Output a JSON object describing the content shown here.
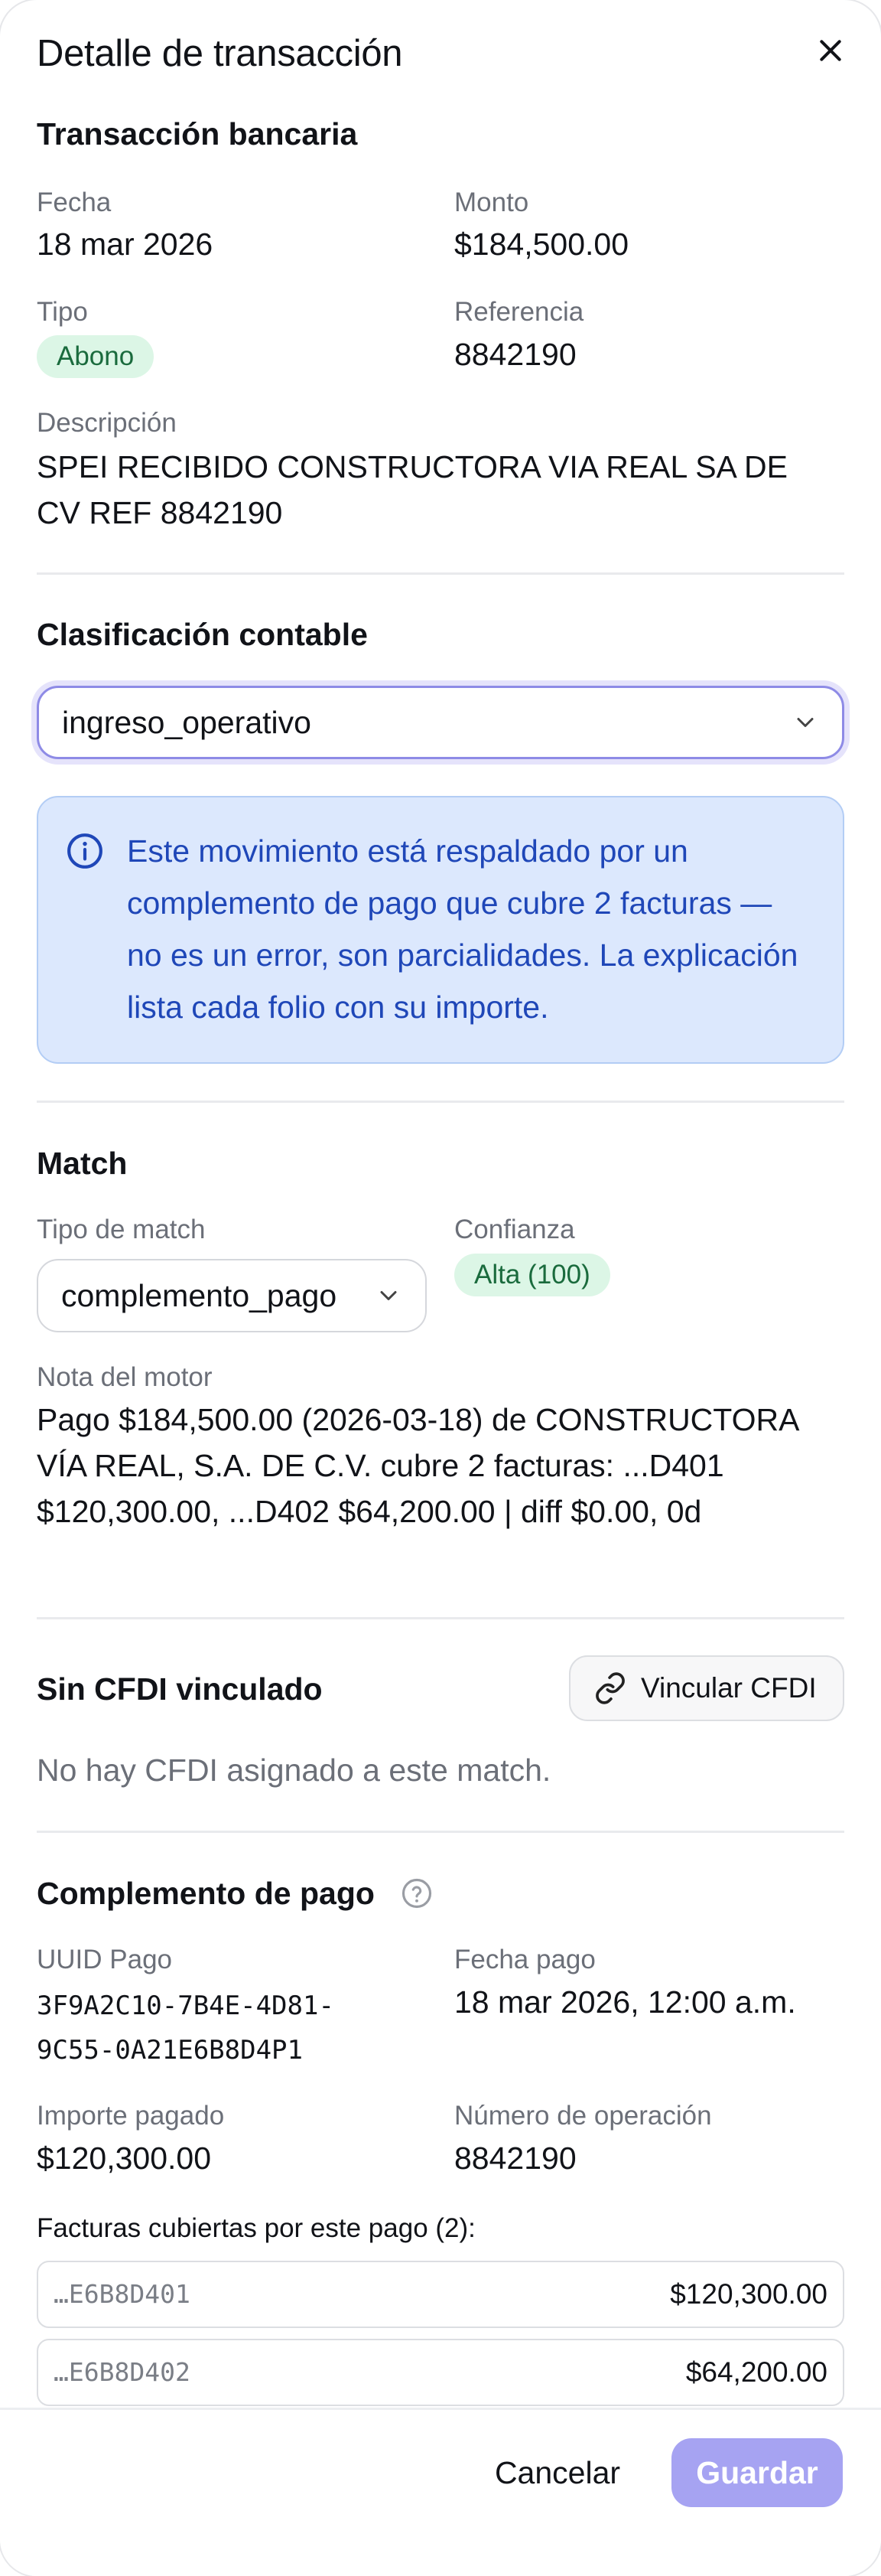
{
  "header": {
    "title": "Detalle de transacción"
  },
  "transaction": {
    "section_title": "Transacción bancaria",
    "fecha_label": "Fecha",
    "fecha_value": "18 mar 2026",
    "monto_label": "Monto",
    "monto_value": "$184,500.00",
    "tipo_label": "Tipo",
    "tipo_value": "Abono",
    "referencia_label": "Referencia",
    "referencia_value": "8842190",
    "descripcion_label": "Descripción",
    "descripcion_value": "SPEI RECIBIDO CONSTRUCTORA VIA REAL SA DE CV REF 8842190"
  },
  "classification": {
    "section_title": "Clasificación contable",
    "selected": "ingreso_operativo",
    "info_text": "Este movimiento está respaldado por un complemento de pago que cubre 2 facturas — no es un error, son parcialidades. La explicación lista cada folio con su importe."
  },
  "match": {
    "section_title": "Match",
    "tipo_label": "Tipo de match",
    "tipo_selected": "complemento_pago",
    "confianza_label": "Confianza",
    "confianza_value": "Alta (100)",
    "nota_label": "Nota del motor",
    "nota_value": "Pago $184,500.00 (2026-03-18) de CONSTRUCTORA VÍA REAL, S.A. DE C.V. cubre 2 facturas: ...D401 $120,300.00, ...D402 $64,200.00 | diff $0.00, 0d"
  },
  "cfdi": {
    "section_title": "Sin CFDI vinculado",
    "link_button": "Vincular CFDI",
    "empty_text": "No hay CFDI asignado a este match."
  },
  "complemento": {
    "section_title": "Complemento de pago",
    "uuid_label": "UUID Pago",
    "uuid_line1": "3F9A2C10-7B4E-4D81-",
    "uuid_line2": "9C55-0A21E6B8D4P1",
    "fecha_label": "Fecha pago",
    "fecha_value": "18 mar 2026, 12:00 a.m.",
    "importe_label": "Importe pagado",
    "importe_value": "$120,300.00",
    "operacion_label": "Número de operación",
    "operacion_value": "8842190",
    "facturas_title": "Facturas cubiertas por este pago (2):",
    "facturas": [
      {
        "uuid": "…E6B8D401",
        "amount": "$120,300.00"
      },
      {
        "uuid": "…E6B8D402",
        "amount": "$64,200.00"
      }
    ]
  },
  "footer": {
    "cancel": "Cancelar",
    "save": "Guardar"
  },
  "colors": {
    "accent": "#8e8be6",
    "save_button": "#a6a3f2",
    "info_bg": "#dce8fd",
    "info_text": "#1f47b8",
    "badge_green_bg": "#dcf6e6",
    "badge_green_text": "#1a6b3d"
  },
  "icons": [
    "close-icon",
    "chevron-down-icon",
    "info-icon",
    "link-icon",
    "help-icon"
  ]
}
